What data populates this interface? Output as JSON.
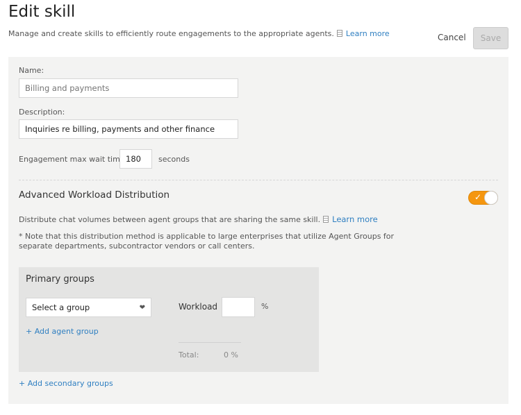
{
  "header": {
    "title": "Edit skill",
    "subtitle": "Manage and create skills to efficiently route engagements to the appropriate agents.",
    "learn_more": "Learn more",
    "cancel": "Cancel",
    "save": "Save"
  },
  "form": {
    "name_label": "Name:",
    "name_placeholder": "Billing and payments",
    "description_label": "Description:",
    "description_value": "Inquiries re billing, payments and other finance",
    "wait_label": "Engagement max wait time",
    "wait_value": "180",
    "wait_unit": "seconds"
  },
  "advanced": {
    "title": "Advanced Workload Distribution",
    "toggle_on": true,
    "toggle_color": "#f5960f",
    "description": "Distribute chat volumes between agent groups that are sharing the same skill.",
    "learn_more": "Learn more",
    "note_line1": "* Note that this distribution method is applicable to large enterprises that utilize Agent Groups for",
    "note_line2": "separate departments, subcontractor vendors or call centers."
  },
  "primary": {
    "title": "Primary groups",
    "select_value": "Select a group",
    "workload_label": "Workload",
    "workload_value": "",
    "percent": "%",
    "add_group": "+ Add agent group",
    "total_label": "Total:",
    "total_value": "0 %"
  },
  "add_secondary": "+ Add secondary groups"
}
